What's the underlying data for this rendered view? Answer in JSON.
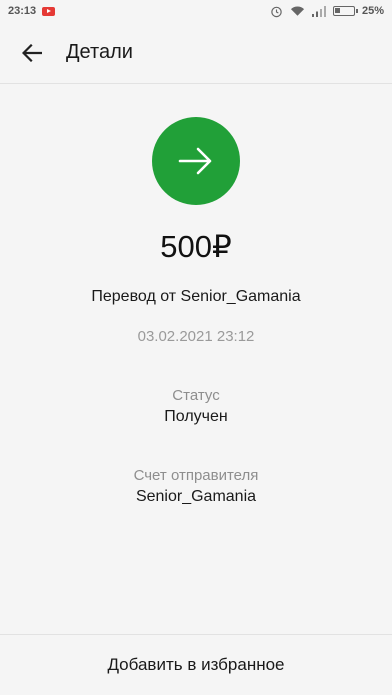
{
  "status_bar": {
    "time": "23:13",
    "battery": "25%",
    "icons": [
      "youtube-icon",
      "alarm-icon",
      "wifi-icon",
      "signal-icon",
      "battery-icon"
    ]
  },
  "app_bar": {
    "title": "Детали",
    "back_icon": "arrow-left-icon"
  },
  "transaction": {
    "icon": "arrow-right-icon",
    "icon_color": "#21a038",
    "amount": "500₽",
    "description": "Перевод от Senior_Gamania",
    "datetime": "03.02.2021 23:12",
    "status_label": "Статус",
    "status_value": "Получен",
    "sender_account_label": "Счет отправителя",
    "sender_account_value": "Senior_Gamania"
  },
  "bottom": {
    "favorite_label": "Добавить в избранное"
  }
}
